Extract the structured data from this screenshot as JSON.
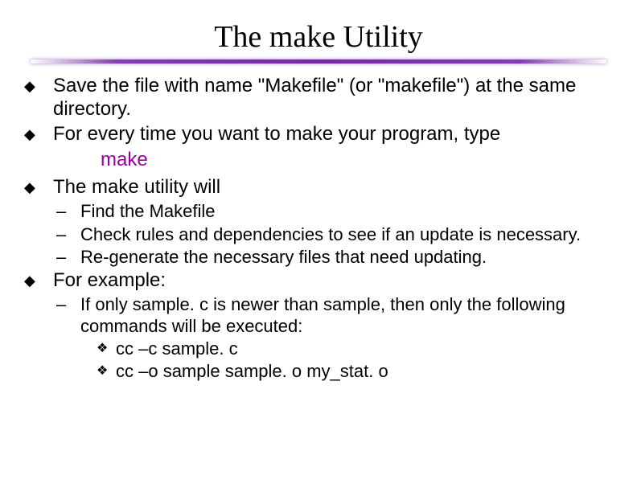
{
  "title": "The make Utility",
  "bullets": {
    "b1a": "Save the file with name \"Makefile\" (or \"makefile\") at the same directory.",
    "b1b": "For every time you want to make your program, type",
    "code": "make",
    "b1c_pre": "The ",
    "b1c_code": "make",
    "b1c_post": " utility will",
    "b2a": "Find the Makefile",
    "b2b": "Check rules and dependencies to see if an update is necessary.",
    "b2c": "Re-generate the necessary files that need updating.",
    "b1d": "For example:",
    "b2d": "If only sample. c is newer than sample, then only the following commands will be executed:",
    "b3a": "cc –c sample. c",
    "b3b": "cc –o sample sample. o my_stat. o"
  }
}
